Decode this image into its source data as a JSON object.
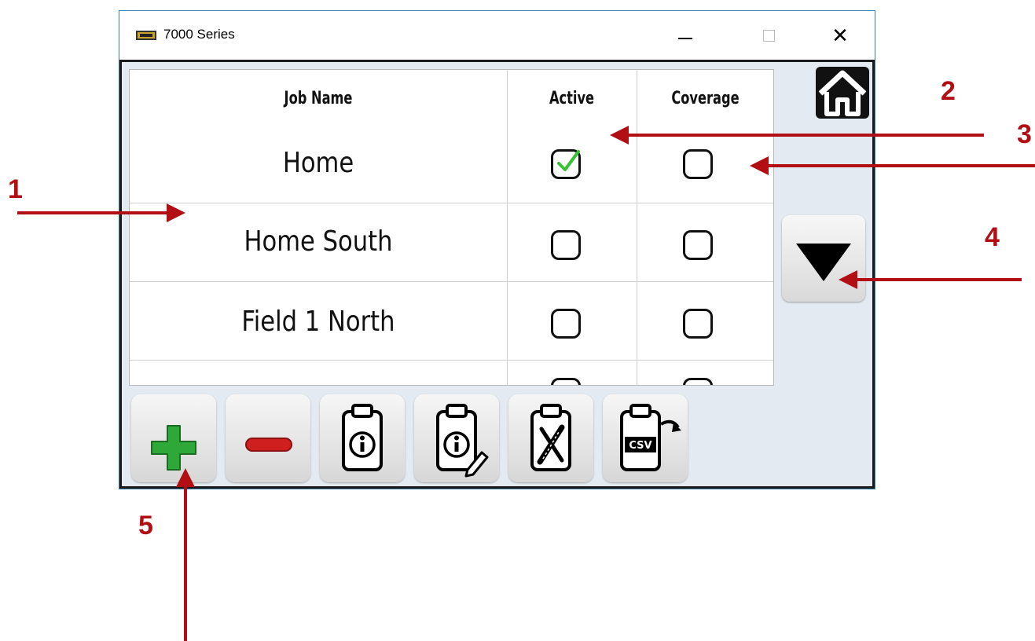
{
  "window": {
    "title": "7000 Series",
    "close_glyph": "✕"
  },
  "table": {
    "headers": {
      "job_name": "Job Name",
      "active": "Active",
      "coverage": "Coverage"
    },
    "rows": [
      {
        "name": "Home",
        "active": true,
        "coverage": false
      },
      {
        "name": "Home South",
        "active": false,
        "coverage": false
      },
      {
        "name": "Field 1 North",
        "active": false,
        "coverage": false
      },
      {
        "name": "",
        "active": false,
        "coverage": false
      }
    ]
  },
  "icons": {
    "home": "home-icon",
    "scroll_down": "triangle-down-icon",
    "add": "plus-icon",
    "remove": "minus-icon",
    "job_info": "clipboard-info-icon",
    "edit_job": "clipboard-edit-icon",
    "job_tools": "clipboard-tools-icon",
    "export_csv": "clipboard-csv-icon"
  },
  "toolbar": {
    "csv_label": "CSV"
  },
  "annotations": [
    "1",
    "2",
    "3",
    "4",
    "5"
  ],
  "colors": {
    "annotation": "#b10f14",
    "check": "#36c231",
    "add": "#2fa83a",
    "remove": "#d01f1f"
  }
}
